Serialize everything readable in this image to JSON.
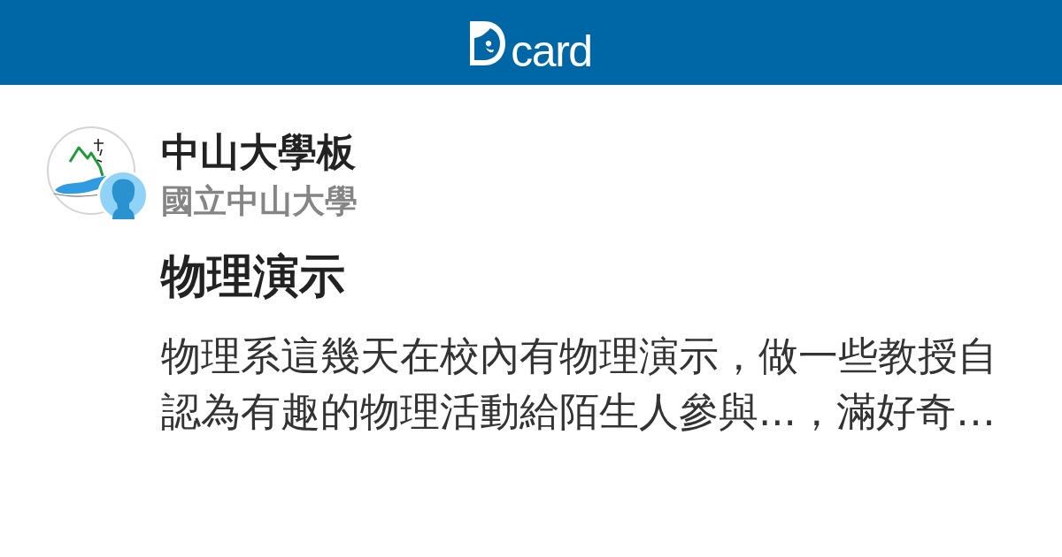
{
  "header": {
    "logo_text": "card"
  },
  "board": {
    "name": "中山大學板",
    "school": "國立中山大學"
  },
  "post": {
    "title": "物理演示",
    "excerpt": "物理系這幾天在校內有物理演示，做一些教授自認為有趣的物理活動給陌生人參與...，滿好奇…"
  }
}
